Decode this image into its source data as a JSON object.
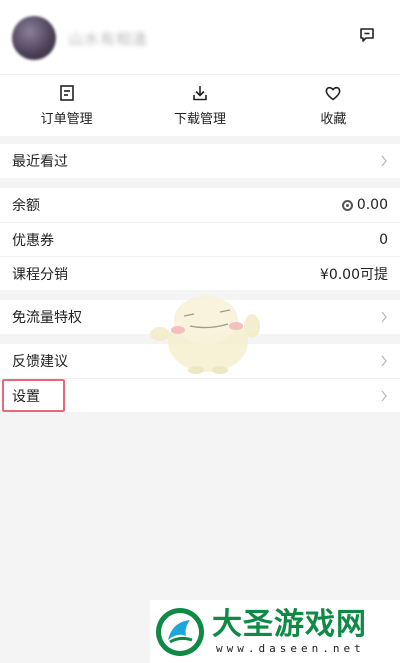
{
  "header": {
    "username": "山水有相逢",
    "message_icon": "message-icon"
  },
  "quick_actions": [
    {
      "label": "订单管理",
      "icon": "order-icon"
    },
    {
      "label": "下载管理",
      "icon": "download-icon"
    },
    {
      "label": "收藏",
      "icon": "heart-icon"
    }
  ],
  "recent": {
    "label": "最近看过"
  },
  "wallet": {
    "balance_label": "余额",
    "balance_value": "0.00",
    "coupon_label": "优惠券",
    "coupon_value": "0",
    "distribution_label": "课程分销",
    "distribution_value": "¥0.00可提"
  },
  "free_traffic": {
    "label": "免流量特权"
  },
  "feedback": {
    "label": "反馈建议"
  },
  "settings": {
    "label": "设置",
    "highlight_color": "#e8687a"
  },
  "watermark": {
    "name": "大圣游戏网",
    "url": "www.daseen.net",
    "brand_color": "#0e8a45"
  }
}
